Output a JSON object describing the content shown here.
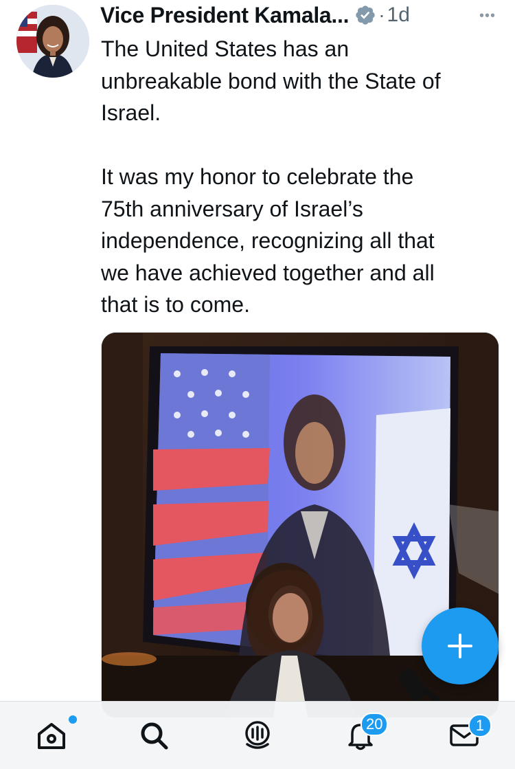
{
  "tweet": {
    "author_name": "Vice President Kamala...",
    "separator": "·",
    "time": "1d",
    "more_label": "•••",
    "text": "The United States has an\nunbreakable bond with the State of\nIsrael.\n\nIt was my honor to celebrate the\n75th anniversary of Israel’s\nindependence, recognizing all that\nwe have achieved together and all\nthat is to come."
  },
  "nav": {
    "notifications_count": "20",
    "messages_count": "1"
  },
  "colors": {
    "accent": "#1d9bf0",
    "text": "#0f1419",
    "muted": "#536471"
  },
  "icons": [
    "verified-badge-icon",
    "more-icon",
    "compose-icon",
    "home-icon",
    "search-icon",
    "spaces-icon",
    "notifications-bell-icon",
    "messages-mail-icon"
  ]
}
